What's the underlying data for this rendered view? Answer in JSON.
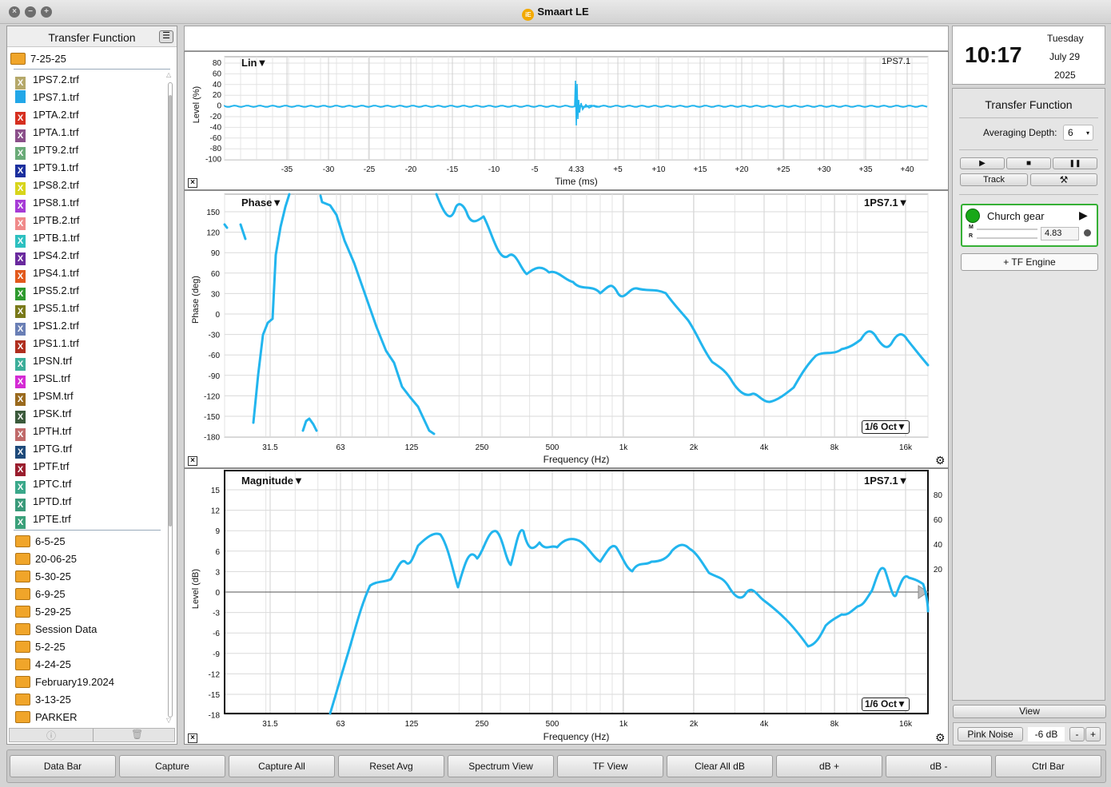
{
  "window": {
    "title": "Smaart LE",
    "logo_text": "iE"
  },
  "sidebar": {
    "title": "Transfer Function",
    "open_folder": "7-25-25",
    "files": [
      {
        "name": "1PS7.2.trf",
        "color": "#b5a86a"
      },
      {
        "name": "1PS7.1.trf",
        "color": "#22a7e8",
        "selected": true
      },
      {
        "name": "1PTA.2.trf",
        "color": "#d62f1f"
      },
      {
        "name": "1PTA.1.trf",
        "color": "#8b4f8a"
      },
      {
        "name": "1PT9.2.trf",
        "color": "#6aab78"
      },
      {
        "name": "1PT9.1.trf",
        "color": "#1b2f9e"
      },
      {
        "name": "1PS8.2.trf",
        "color": "#d8d51b"
      },
      {
        "name": "1PS8.1.trf",
        "color": "#a63bd6"
      },
      {
        "name": "1PTB.2.trf",
        "color": "#f08a8a"
      },
      {
        "name": "1PTB.1.trf",
        "color": "#2dc0c0"
      },
      {
        "name": "1PS4.2.trf",
        "color": "#6a2a9e"
      },
      {
        "name": "1PS4.1.trf",
        "color": "#e2591c"
      },
      {
        "name": "1PS5.2.trf",
        "color": "#2e9a2e"
      },
      {
        "name": "1PS5.1.trf",
        "color": "#7a7a1a"
      },
      {
        "name": "1PS1.2.trf",
        "color": "#6a7fb5"
      },
      {
        "name": "1PS1.1.trf",
        "color": "#b02e1e"
      },
      {
        "name": "1PSN.trf",
        "color": "#3cae9a"
      },
      {
        "name": "1PSL.trf",
        "color": "#d42bd4"
      },
      {
        "name": "1PSM.trf",
        "color": "#9a6a1e"
      },
      {
        "name": "1PSK.trf",
        "color": "#3b5a3b"
      },
      {
        "name": "1PTH.trf",
        "color": "#c06a6a"
      },
      {
        "name": "1PTG.trf",
        "color": "#1e4a7a"
      },
      {
        "name": "1PTF.trf",
        "color": "#9a1e2e"
      },
      {
        "name": "1PTC.trf",
        "color": "#3aa88a"
      },
      {
        "name": "1PTD.trf",
        "color": "#3a9a7a"
      },
      {
        "name": "1PTE.trf",
        "color": "#3aa07a"
      }
    ],
    "folders": [
      "6-5-25",
      "20-06-25",
      "5-30-25",
      "6-9-25",
      "5-29-25",
      "Session Data",
      "5-2-25",
      "4-24-25",
      "February19.2024",
      "3-13-25",
      "PARKER"
    ]
  },
  "lin_plot": {
    "title": "Lin▼",
    "trace": "1PS7.1",
    "ylabel": "Level (%)",
    "xlabel": "Time (ms)",
    "yticks": [
      "80",
      "60",
      "40",
      "20",
      "0",
      "-20",
      "-40",
      "-60",
      "-80",
      "-100"
    ],
    "xticks": [
      "-35",
      "-30",
      "-25",
      "-20",
      "-15",
      "-10",
      "-5",
      "4.33",
      "+5",
      "+10",
      "+15",
      "+20",
      "+25",
      "+30",
      "+35",
      "+40"
    ]
  },
  "phase_plot": {
    "title": "Phase▼",
    "trace": "1PS7.1▼",
    "ylabel": "Phase (deg)",
    "xlabel": "Frequency (Hz)",
    "yticks": [
      "150",
      "120",
      "90",
      "60",
      "30",
      "0",
      "-30",
      "-60",
      "-90",
      "-120",
      "-150",
      "-180"
    ],
    "xticks": [
      "31.5",
      "63",
      "125",
      "250",
      "500",
      "1k",
      "2k",
      "4k",
      "8k",
      "16k"
    ],
    "smoothing": "1/6 Oct▼"
  },
  "mag_plot": {
    "title": "Magnitude▼",
    "trace": "1PS7.1▼",
    "ylabel": "Level (dB)",
    "xlabel": "Frequency (Hz)",
    "yticks": [
      "15",
      "12",
      "9",
      "6",
      "3",
      "0",
      "-3",
      "-6",
      "-9",
      "-12",
      "-15",
      "-18"
    ],
    "right_ticks": [
      "80",
      "60",
      "40",
      "20"
    ],
    "xticks": [
      "31.5",
      "63",
      "125",
      "250",
      "500",
      "1k",
      "2k",
      "4k",
      "8k",
      "16k"
    ],
    "smoothing": "1/6 Oct▼"
  },
  "clock": {
    "time": "10:17",
    "day": "Tuesday",
    "date": "July 29",
    "year": "2025"
  },
  "control": {
    "title": "Transfer Function",
    "avg_label": "Averaging Depth:",
    "avg_value": "6",
    "play_icon": "▶",
    "stop_icon": "■",
    "pause_icon": "❚❚",
    "track_label": "Track",
    "tools_icon": "⚒",
    "engine_name": "Church gear",
    "engine_m": "M",
    "engine_r": "R",
    "delay_value": "4.83",
    "add_engine": "+ TF Engine",
    "view_label": "View",
    "pink_noise": "Pink Noise",
    "noise_level": "-6 dB",
    "minus": "-",
    "plus": "+"
  },
  "bottom_bar": [
    "Data Bar",
    "Capture",
    "Capture All",
    "Reset Avg",
    "Spectrum View",
    "TF View",
    "Clear All dB",
    "dB +",
    "dB -",
    "Ctrl Bar"
  ]
}
